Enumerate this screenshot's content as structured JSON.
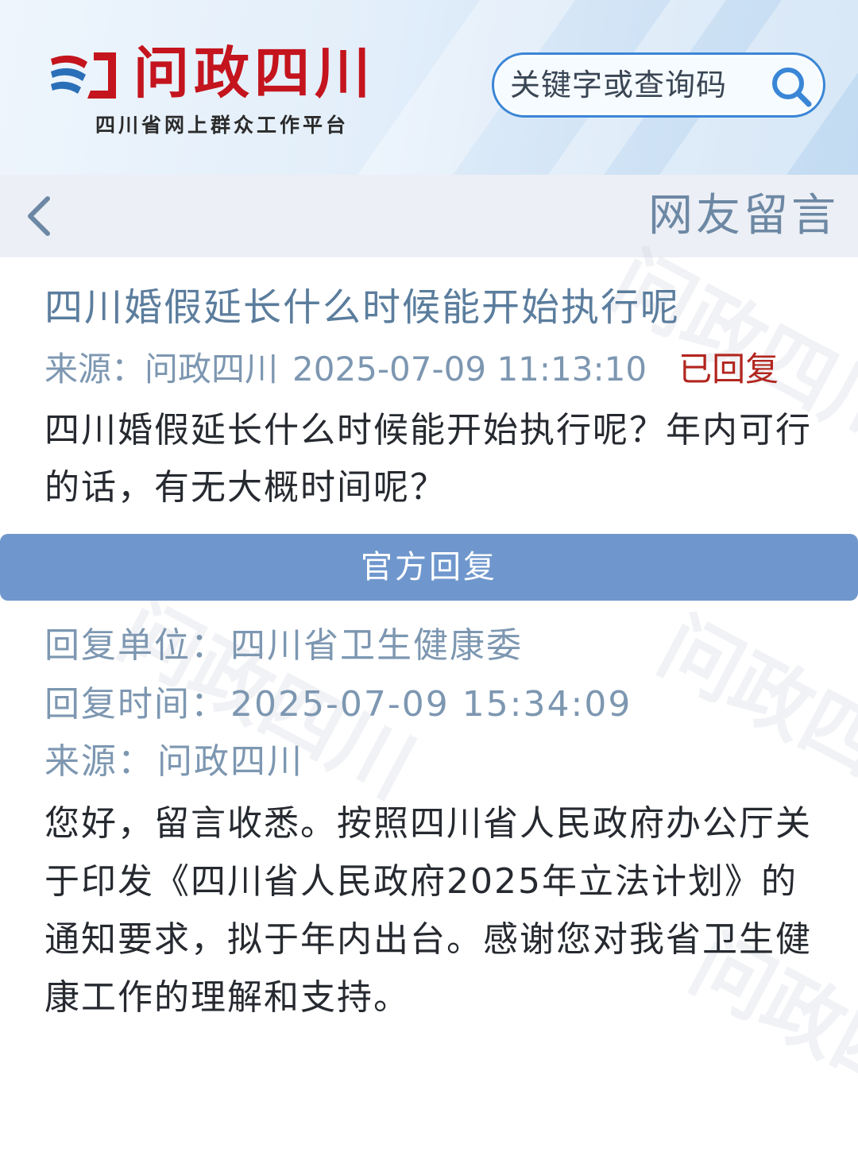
{
  "header": {
    "logo_title": "问政四川",
    "logo_subtitle": "四川省网上群众工作平台",
    "search_placeholder": "关键字或查询码",
    "brand_red": "#c4141d",
    "search_border": "#3a86d6"
  },
  "nav": {
    "back_icon": "chevron-left-icon",
    "title": "网友留言"
  },
  "question": {
    "title": "四川婚假延长什么时候能开始执行呢",
    "source": "来源：问政四川",
    "datetime": "2025-07-09 11:13:10",
    "status": "已回复",
    "status_color": "#b22620",
    "body": "四川婚假延长什么时候能开始执行呢？年内可行的话，有无大概时间呢？"
  },
  "reply": {
    "section_label": "官方回复",
    "section_color": "#6f97cd",
    "unit_label": "回复单位：",
    "unit_value": "四川省卫生健康委",
    "time_label": "回复时间：",
    "time_value": "2025-07-09 15:34:09",
    "source_label": "来源：",
    "source_value": "问政四川",
    "body": "您好，留言收悉。按照四川省人民政府办公厅关于印发《四川省人民政府2025年立法计划》的通知要求，拟于年内出台。感谢您对我省卫生健康工作的理解和支持。"
  },
  "watermark_text": "问政四川"
}
